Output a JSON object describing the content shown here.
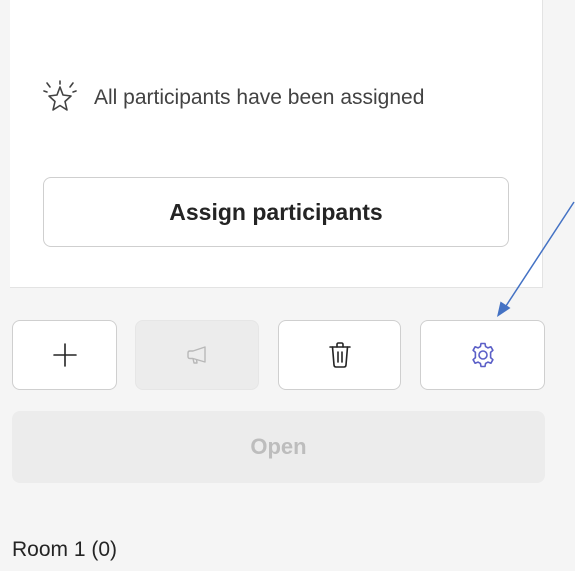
{
  "status": {
    "icon": "sparkle-icon",
    "text": "All participants have been assigned"
  },
  "assign_button": {
    "label": "Assign participants"
  },
  "toolbar": {
    "buttons": [
      {
        "name": "add",
        "icon": "plus-icon",
        "enabled": true
      },
      {
        "name": "announce",
        "icon": "megaphone-icon",
        "enabled": false
      },
      {
        "name": "delete",
        "icon": "trash-icon",
        "enabled": true
      },
      {
        "name": "settings",
        "icon": "gear-icon",
        "enabled": true,
        "icon_color": "#5b5fc7"
      }
    ]
  },
  "open_button": {
    "label": "Open",
    "enabled": false
  },
  "rooms": [
    {
      "label": "Room 1",
      "count": "(0)"
    }
  ],
  "annotation": {
    "arrow_color": "#4472c4"
  }
}
